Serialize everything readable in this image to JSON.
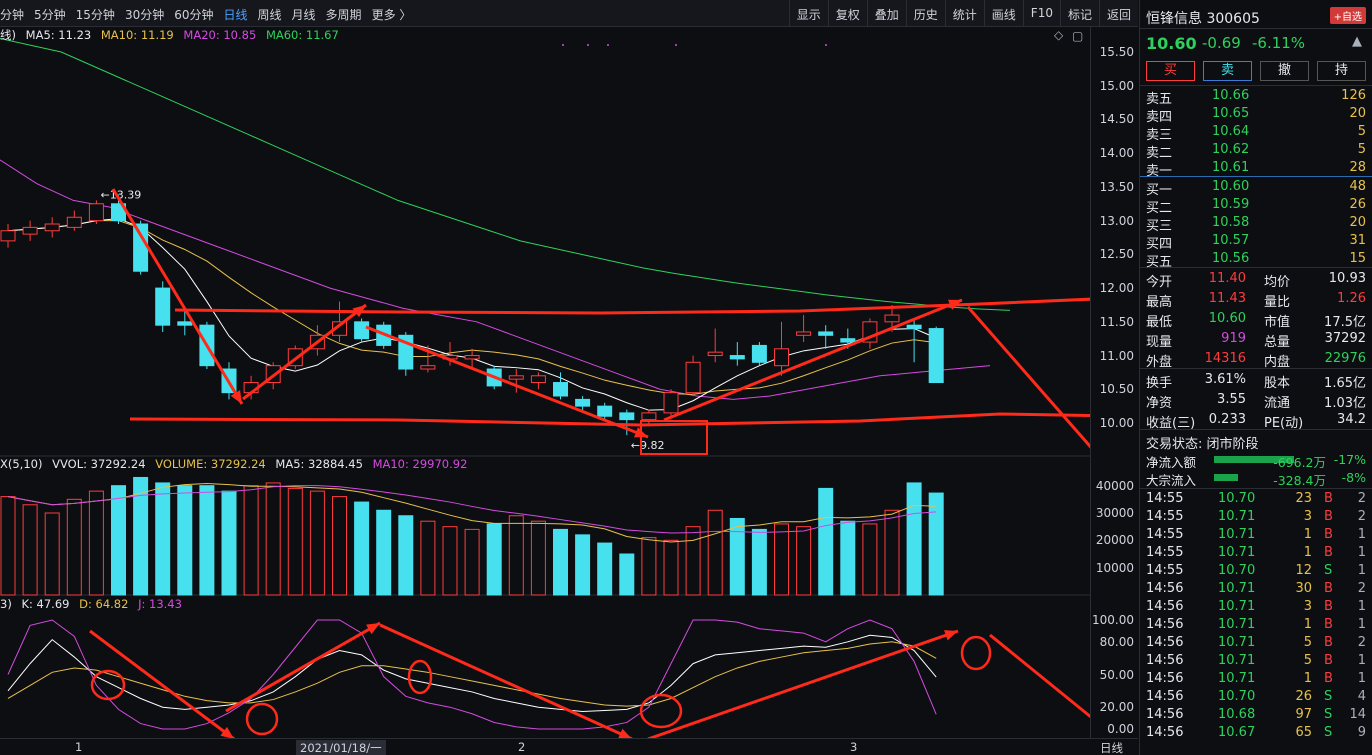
{
  "toolbar": {
    "periods": [
      "分钟",
      "5分钟",
      "15分钟",
      "30分钟",
      "60分钟",
      "日线",
      "周线",
      "月线",
      "多周期",
      "更多 〉"
    ],
    "active": "日线",
    "tools": [
      "显示",
      "复权",
      "叠加",
      "历史",
      "统计",
      "画线",
      "F10",
      "标记",
      "返回"
    ]
  },
  "ma_legend": {
    "prefix": "线)",
    "ma5": "MA5: 11.23",
    "ma10": "MA10: 11.19",
    "ma20": "MA20: 10.85",
    "ma60": "MA60: 11.67"
  },
  "vol_legend": {
    "prefix": "X(5,10)",
    "vvol": "VVOL: 37292.24",
    "volume": "VOLUME: 37292.24",
    "ma5": "MA5: 32884.45",
    "ma10": "MA10: 29970.92"
  },
  "kdj_legend": {
    "prefix": "3)",
    "k": "K: 47.69",
    "d": "D: 64.82",
    "j": "J: 13.43"
  },
  "price_axis": [
    "15.50",
    "15.00",
    "14.50",
    "14.00",
    "13.50",
    "13.00",
    "12.50",
    "12.00",
    "11.50",
    "11.00",
    "10.50",
    "10.00"
  ],
  "vol_axis": [
    "40000",
    "30000",
    "20000",
    "10000"
  ],
  "kdj_axis": [
    "100.00",
    "80.00",
    "50.00",
    "20.00",
    "0.00"
  ],
  "x_axis": {
    "m1": "1",
    "date": "2021/01/18/一",
    "m2": "2",
    "m3": "3",
    "period": "日线"
  },
  "annotations": {
    "high": "13.39",
    "low": "9.82"
  },
  "colors": {
    "up": "#ff3c3c",
    "down": "#46e0ef",
    "ma5": "#ffffff",
    "ma10": "#e8c14a",
    "ma20": "#d44be0",
    "ma60": "#2fd15c",
    "drawing": "#ff2a1a"
  },
  "stock": {
    "name": "恒锋信息 300605",
    "fav": "+自选",
    "price": "10.60",
    "change": "-0.69",
    "pct": "-6.11%"
  },
  "actions": [
    "买",
    "卖",
    "撤",
    "持"
  ],
  "sell": [
    {
      "label": "卖五",
      "price": "10.66",
      "vol": "126"
    },
    {
      "label": "卖四",
      "price": "10.65",
      "vol": "20"
    },
    {
      "label": "卖三",
      "price": "10.64",
      "vol": "5"
    },
    {
      "label": "卖二",
      "price": "10.62",
      "vol": "5"
    },
    {
      "label": "卖一",
      "price": "10.61",
      "vol": "28"
    }
  ],
  "buy": [
    {
      "label": "买一",
      "price": "10.60",
      "vol": "48"
    },
    {
      "label": "买二",
      "price": "10.59",
      "vol": "26"
    },
    {
      "label": "买三",
      "price": "10.58",
      "vol": "20"
    },
    {
      "label": "买四",
      "price": "10.57",
      "vol": "31"
    },
    {
      "label": "买五",
      "price": "10.56",
      "vol": "15"
    }
  ],
  "stats": [
    {
      "l1": "今开",
      "v1": "11.40",
      "l2": "均价",
      "v2": "10.93"
    },
    {
      "l1": "最高",
      "v1": "11.43",
      "l2": "量比",
      "v2": "1.26"
    },
    {
      "l1": "最低",
      "v1": "10.60",
      "l2": "市值",
      "v2": "17.5亿"
    },
    {
      "l1": "现量",
      "v1": "919",
      "l2": "总量",
      "v2": "37292"
    },
    {
      "l1": "外盘",
      "v1": "14316",
      "l2": "内盘",
      "v2": "22976"
    }
  ],
  "stats2": [
    {
      "l1": "换手",
      "v1": "3.61%",
      "l2": "股本",
      "v2": "1.65亿"
    },
    {
      "l1": "净资",
      "v1": "3.55",
      "l2": "流通",
      "v2": "1.03亿"
    },
    {
      "l1": "收益(三)",
      "v1": "0.233",
      "l2": "PE(动)",
      "v2": "34.2"
    }
  ],
  "trade_status": "交易状态: 闭市阶段",
  "flows": [
    {
      "label": "净流入额",
      "value": "-696.2万",
      "pct": "-17%"
    },
    {
      "label": "大宗流入",
      "value": "-328.4万",
      "pct": "-8%"
    }
  ],
  "ticks": [
    {
      "t": "14:55",
      "p": "10.70",
      "v": "23",
      "s": "B",
      "n": "2"
    },
    {
      "t": "14:55",
      "p": "10.71",
      "v": "3",
      "s": "B",
      "n": "2"
    },
    {
      "t": "14:55",
      "p": "10.71",
      "v": "1",
      "s": "B",
      "n": "1"
    },
    {
      "t": "14:55",
      "p": "10.71",
      "v": "1",
      "s": "B",
      "n": "1"
    },
    {
      "t": "14:55",
      "p": "10.70",
      "v": "12",
      "s": "S",
      "n": "1"
    },
    {
      "t": "14:56",
      "p": "10.71",
      "v": "30",
      "s": "B",
      "n": "2"
    },
    {
      "t": "14:56",
      "p": "10.71",
      "v": "3",
      "s": "B",
      "n": "1"
    },
    {
      "t": "14:56",
      "p": "10.71",
      "v": "1",
      "s": "B",
      "n": "1"
    },
    {
      "t": "14:56",
      "p": "10.71",
      "v": "5",
      "s": "B",
      "n": "2"
    },
    {
      "t": "14:56",
      "p": "10.71",
      "v": "5",
      "s": "B",
      "n": "1"
    },
    {
      "t": "14:56",
      "p": "10.71",
      "v": "1",
      "s": "B",
      "n": "1"
    },
    {
      "t": "14:56",
      "p": "10.70",
      "v": "26",
      "s": "S",
      "n": "4"
    },
    {
      "t": "14:56",
      "p": "10.68",
      "v": "97",
      "s": "S",
      "n": "14"
    },
    {
      "t": "14:56",
      "p": "10.67",
      "v": "65",
      "s": "S",
      "n": "9"
    }
  ],
  "candles": [
    {
      "o": 12.7,
      "h": 12.95,
      "l": 12.6,
      "c": 12.85
    },
    {
      "o": 12.8,
      "h": 13.0,
      "l": 12.7,
      "c": 12.9
    },
    {
      "o": 12.85,
      "h": 13.05,
      "l": 12.75,
      "c": 12.95
    },
    {
      "o": 12.9,
      "h": 13.15,
      "l": 12.85,
      "c": 13.05
    },
    {
      "o": 13.0,
      "h": 13.3,
      "l": 12.95,
      "c": 13.25
    },
    {
      "o": 13.25,
      "h": 13.39,
      "l": 12.95,
      "c": 13.0
    },
    {
      "o": 12.95,
      "h": 13.0,
      "l": 12.2,
      "c": 12.25
    },
    {
      "o": 12.0,
      "h": 12.1,
      "l": 11.35,
      "c": 11.45
    },
    {
      "o": 11.5,
      "h": 11.7,
      "l": 11.3,
      "c": 11.45
    },
    {
      "o": 11.45,
      "h": 11.5,
      "l": 10.8,
      "c": 10.85
    },
    {
      "o": 10.8,
      "h": 10.9,
      "l": 10.35,
      "c": 10.45
    },
    {
      "o": 10.45,
      "h": 10.7,
      "l": 10.35,
      "c": 10.6
    },
    {
      "o": 10.6,
      "h": 10.9,
      "l": 10.5,
      "c": 10.85
    },
    {
      "o": 10.85,
      "h": 11.15,
      "l": 10.8,
      "c": 11.1
    },
    {
      "o": 11.1,
      "h": 11.45,
      "l": 11.0,
      "c": 11.3
    },
    {
      "o": 11.3,
      "h": 11.8,
      "l": 11.2,
      "c": 11.5
    },
    {
      "o": 11.5,
      "h": 11.55,
      "l": 11.2,
      "c": 11.25
    },
    {
      "o": 11.45,
      "h": 11.5,
      "l": 11.1,
      "c": 11.15
    },
    {
      "o": 11.3,
      "h": 11.35,
      "l": 10.7,
      "c": 10.8
    },
    {
      "o": 10.8,
      "h": 11.15,
      "l": 10.75,
      "c": 10.85
    },
    {
      "o": 10.95,
      "h": 11.2,
      "l": 10.85,
      "c": 11.0
    },
    {
      "o": 10.95,
      "h": 11.1,
      "l": 10.8,
      "c": 11.0
    },
    {
      "o": 10.8,
      "h": 10.85,
      "l": 10.5,
      "c": 10.55
    },
    {
      "o": 10.65,
      "h": 10.8,
      "l": 10.45,
      "c": 10.7
    },
    {
      "o": 10.6,
      "h": 10.75,
      "l": 10.5,
      "c": 10.7
    },
    {
      "o": 10.6,
      "h": 10.75,
      "l": 10.35,
      "c": 10.4
    },
    {
      "o": 10.35,
      "h": 10.4,
      "l": 10.15,
      "c": 10.25
    },
    {
      "o": 10.25,
      "h": 10.3,
      "l": 10.05,
      "c": 10.1
    },
    {
      "o": 10.15,
      "h": 10.2,
      "l": 9.82,
      "c": 10.05
    },
    {
      "o": 10.05,
      "h": 10.2,
      "l": 9.95,
      "c": 10.15
    },
    {
      "o": 10.15,
      "h": 10.5,
      "l": 10.1,
      "c": 10.45
    },
    {
      "o": 10.45,
      "h": 11.0,
      "l": 10.4,
      "c": 10.9
    },
    {
      "o": 11.0,
      "h": 11.4,
      "l": 10.9,
      "c": 11.05
    },
    {
      "o": 11.0,
      "h": 11.2,
      "l": 10.85,
      "c": 10.95
    },
    {
      "o": 11.15,
      "h": 11.2,
      "l": 10.85,
      "c": 10.9
    },
    {
      "o": 10.85,
      "h": 11.5,
      "l": 10.7,
      "c": 11.1
    },
    {
      "o": 11.3,
      "h": 11.6,
      "l": 11.2,
      "c": 11.35
    },
    {
      "o": 11.35,
      "h": 11.45,
      "l": 11.1,
      "c": 11.3
    },
    {
      "o": 11.25,
      "h": 11.4,
      "l": 11.1,
      "c": 11.2
    },
    {
      "o": 11.2,
      "h": 11.55,
      "l": 11.1,
      "c": 11.5
    },
    {
      "o": 11.5,
      "h": 11.75,
      "l": 11.35,
      "c": 11.6
    },
    {
      "o": 11.45,
      "h": 11.55,
      "l": 10.9,
      "c": 11.4
    },
    {
      "o": 11.4,
      "h": 11.43,
      "l": 10.6,
      "c": 10.6
    }
  ],
  "volumes": [
    36000,
    33000,
    30000,
    35000,
    38000,
    40000,
    43000,
    41000,
    40000,
    40000,
    38000,
    40000,
    41000,
    39000,
    38000,
    36000,
    34000,
    31000,
    29000,
    27000,
    25000,
    24000,
    26000,
    29000,
    27000,
    24000,
    22000,
    19000,
    15000,
    21000,
    20000,
    25000,
    31000,
    28000,
    24000,
    26000,
    25000,
    39000,
    27000,
    26000,
    31000,
    41000,
    37292
  ],
  "k_vals": [
    35,
    60,
    82,
    66,
    48,
    38,
    28,
    20,
    18,
    20,
    22,
    26,
    34,
    48,
    64,
    72,
    68,
    54,
    46,
    42,
    38,
    34,
    28,
    24,
    20,
    18,
    16,
    17,
    18,
    24,
    40,
    60,
    68,
    70,
    72,
    74,
    76,
    75,
    80,
    86,
    84,
    72,
    47.69
  ],
  "d_vals": [
    28,
    40,
    52,
    56,
    54,
    48,
    42,
    36,
    30,
    26,
    24,
    24,
    27,
    34,
    42,
    52,
    58,
    58,
    55,
    52,
    48,
    44,
    40,
    36,
    32,
    28,
    25,
    22,
    21,
    22,
    28,
    38,
    48,
    56,
    62,
    66,
    70,
    72,
    74,
    78,
    80,
    76,
    64.82
  ],
  "j_vals": [
    50,
    95,
    100,
    85,
    40,
    18,
    5,
    0,
    0,
    5,
    15,
    28,
    50,
    75,
    100,
    100,
    88,
    48,
    30,
    24,
    20,
    14,
    6,
    2,
    0,
    0,
    0,
    2,
    6,
    20,
    60,
    100,
    100,
    98,
    92,
    90,
    88,
    80,
    92,
    100,
    92,
    62,
    13.43
  ],
  "ma60_curve": [
    15.7,
    15.6,
    15.5,
    15.3,
    15.1,
    14.9,
    14.7,
    14.5,
    14.3,
    14.1,
    13.9,
    13.7,
    13.5,
    13.3,
    13.15,
    13.0,
    12.85,
    12.7,
    12.6,
    12.5,
    12.4,
    12.3,
    12.22,
    12.15,
    12.08,
    12.02,
    11.96,
    11.9,
    11.85,
    11.8,
    11.76,
    11.72,
    11.69,
    11.67
  ],
  "ma20_curve": [
    13.9,
    13.55,
    13.3,
    13.2,
    13.0,
    12.8,
    12.6,
    12.4,
    12.2,
    12.0,
    11.85,
    11.7,
    11.6,
    11.5,
    11.3,
    11.1,
    10.9,
    10.7,
    10.5,
    10.4,
    10.35,
    10.4,
    10.5,
    10.6,
    10.7,
    10.75,
    10.8,
    10.85
  ]
}
